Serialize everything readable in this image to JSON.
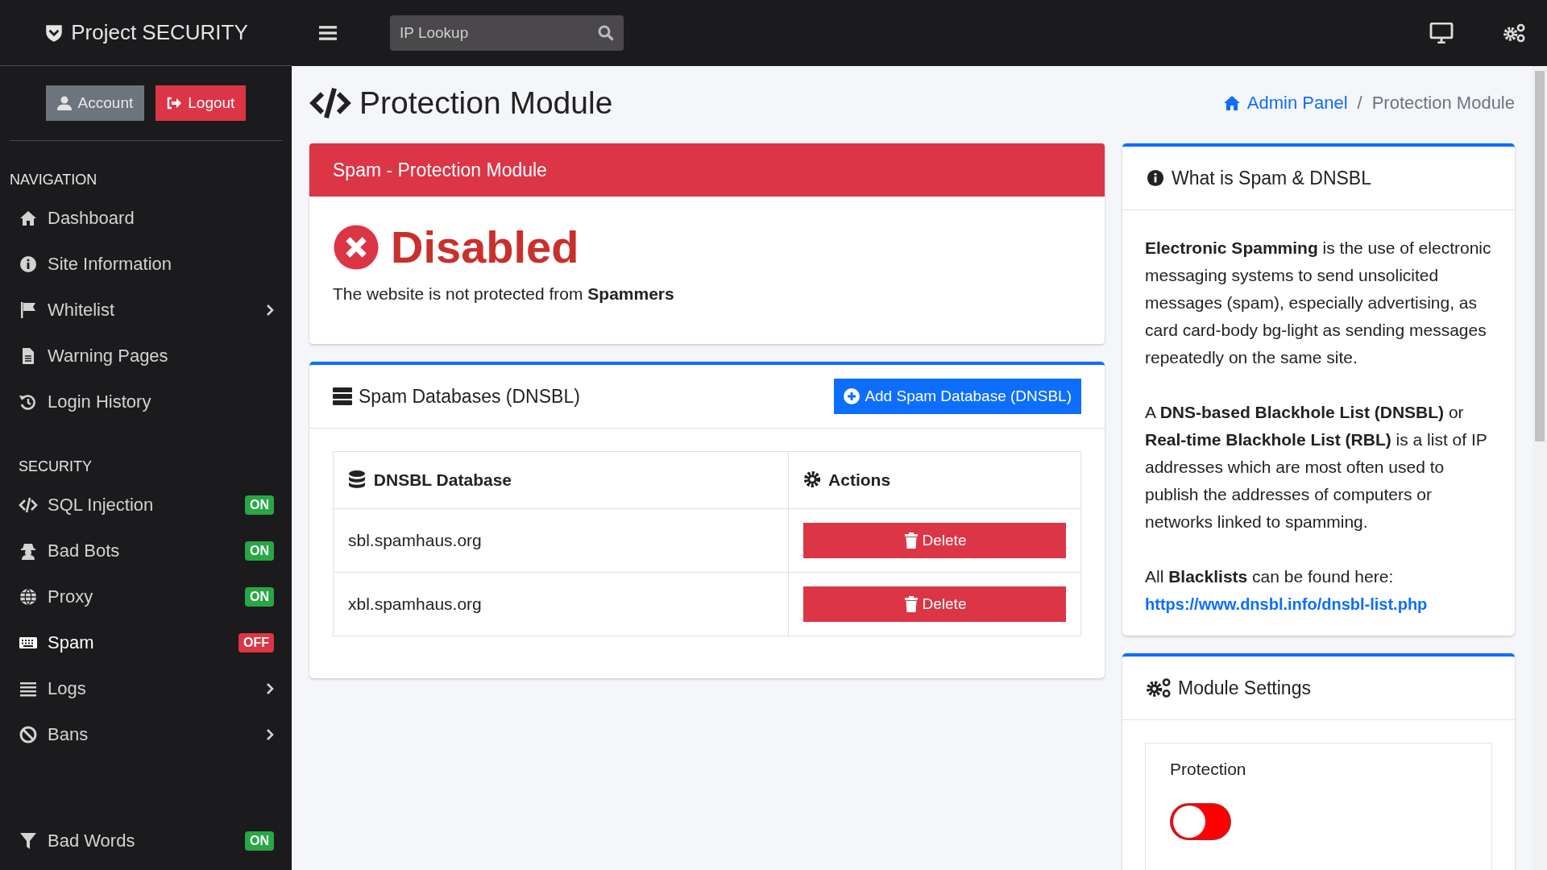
{
  "brand": {
    "title": "Project SECURITY"
  },
  "search": {
    "placeholder": "IP Lookup"
  },
  "account_buttons": [
    {
      "kind": "account",
      "label": "Account"
    },
    {
      "kind": "logout",
      "label": "Logout"
    }
  ],
  "sidebar": {
    "sections": [
      {
        "heading": "NAVIGATION",
        "items": [
          {
            "label": "Dashboard",
            "kind": "link",
            "selected": false
          },
          {
            "label": "Site Information",
            "kind": "link",
            "selected": false
          },
          {
            "label": "Whitelist",
            "kind": "submenu",
            "selected": false
          },
          {
            "label": "Warning Pages",
            "kind": "link",
            "selected": false
          },
          {
            "label": "Login History",
            "kind": "link",
            "selected": false
          }
        ]
      },
      {
        "heading": "SECURITY",
        "items": [
          {
            "label": "SQL Injection",
            "kind": "badge",
            "badge": "ON",
            "enabled": true,
            "selected": false
          },
          {
            "label": "Bad Bots",
            "kind": "badge",
            "badge": "ON",
            "enabled": true,
            "selected": false
          },
          {
            "label": "Proxy",
            "kind": "badge",
            "badge": "ON",
            "enabled": true,
            "selected": false
          },
          {
            "label": "Spam",
            "kind": "badge",
            "badge": "OFF",
            "enabled": false,
            "selected": true
          },
          {
            "label": "Logs",
            "kind": "submenu",
            "selected": false
          },
          {
            "label": "Bans",
            "kind": "submenu",
            "selected": false
          }
        ]
      }
    ],
    "bottom_items": [
      {
        "label": "Bad Words",
        "kind": "badge",
        "badge": "ON",
        "enabled": true,
        "selected": false
      }
    ]
  },
  "page": {
    "title": "Protection Module",
    "breadcrumb": [
      {
        "label": "Admin Panel",
        "link": true
      },
      {
        "label": "Protection Module",
        "link": false
      }
    ],
    "breadcrumb_separator": "/"
  },
  "status_card": {
    "header": "Spam - Protection Module",
    "status": "Disabled",
    "enabled": false,
    "message": "The website is not protected from **Spammers**"
  },
  "databases_card": {
    "title": "Spam Databases (DNSBL)",
    "add_button": "Add Spam Database (DNSBL)",
    "table": {
      "columns": [
        "DNSBL Database",
        "Actions"
      ],
      "rows": [
        {
          "database": "sbl.spamhaus.org",
          "action": "Delete"
        },
        {
          "database": "xbl.spamhaus.org",
          "action": "Delete"
        }
      ]
    }
  },
  "info_card": {
    "title": "What is Spam & DNSBL",
    "paragraphs": [
      "**Electronic Spamming** is the use of electronic messaging systems to send unsolicited messages (spam), especially advertising, as card card-body bg-light as sending messages repeatedly on the same site.",
      "A **DNS-based Blackhole List (DNSBL)** or **Real-time Blackhole List (RBL)** is a list of IP addresses which are most often used to publish the addresses of computers or networks linked to spamming.",
      "All **Blacklists** can be found here:"
    ],
    "link": "https://www.dnsbl.info/dnsbl-list.php"
  },
  "settings_card": {
    "title": "Module Settings",
    "setting": {
      "label": "Protection",
      "on": false
    }
  }
}
